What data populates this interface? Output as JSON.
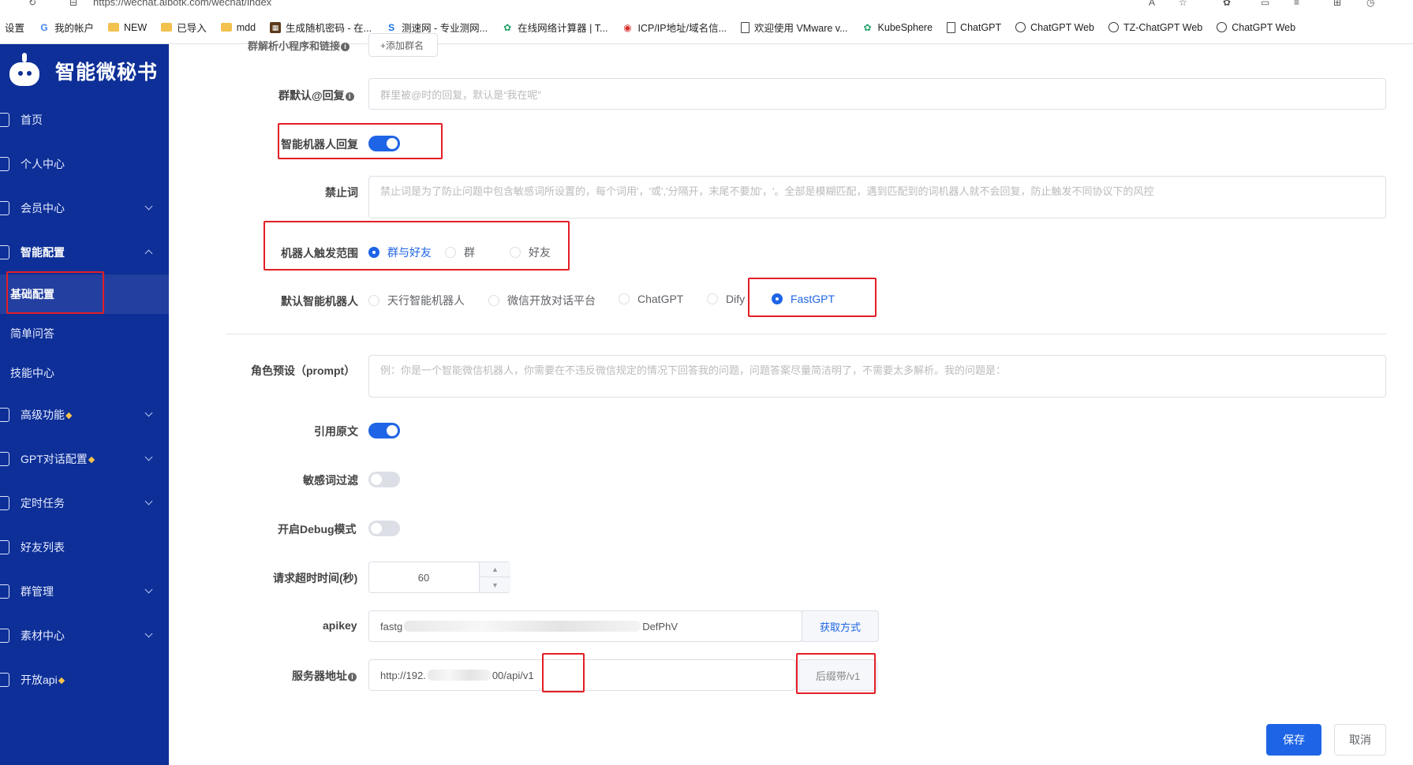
{
  "browser": {
    "url": "https://wechat.aibotk.com/wechat/index",
    "bookmarks": [
      {
        "label": "设置",
        "icon": "none-icon",
        "cls": ""
      },
      {
        "label": "我的帐户",
        "icon": "google-icon",
        "cls": "g"
      },
      {
        "label": "NEW",
        "icon": "folder-icon",
        "cls": "folder"
      },
      {
        "label": "已导入",
        "icon": "folder-icon",
        "cls": "folder"
      },
      {
        "label": "mdd",
        "icon": "folder-icon",
        "cls": "folder"
      },
      {
        "label": "生成随机密码 - 在...",
        "icon": "app-icon",
        "cls": "dark"
      },
      {
        "label": "测速网 - 专业测网...",
        "icon": "speed-icon",
        "cls": "blue"
      },
      {
        "label": "在线网络计算器 | T...",
        "icon": "gear-icon",
        "cls": "green"
      },
      {
        "label": "ICP/IP地址/域名信...",
        "icon": "site-icon",
        "cls": "red"
      },
      {
        "label": "欢迎使用 VMware v...",
        "icon": "page-icon",
        "cls": "doc"
      },
      {
        "label": "KubeSphere",
        "icon": "kubesphere-icon",
        "cls": "green"
      },
      {
        "label": "ChatGPT",
        "icon": "page-icon",
        "cls": "doc"
      },
      {
        "label": "ChatGPT Web",
        "icon": "openai-icon",
        "cls": "round"
      },
      {
        "label": "TZ-ChatGPT Web",
        "icon": "openai-icon",
        "cls": "round"
      },
      {
        "label": "ChatGPT Web",
        "icon": "openai-icon",
        "cls": "round"
      }
    ]
  },
  "sidebar": {
    "brand": "智能微秘书",
    "items": [
      {
        "label": "首页",
        "chevron": false
      },
      {
        "label": "个人中心",
        "chevron": false
      },
      {
        "label": "会员中心",
        "chevron": true
      }
    ],
    "open_group": {
      "label": "智能配置",
      "children": [
        "基础配置",
        "简单问答",
        "技能中心"
      ],
      "active": "基础配置"
    },
    "items_after": [
      {
        "label": "高级功能",
        "gem": true
      },
      {
        "label": "GPT对话配置",
        "gem": true
      },
      {
        "label": "定时任务",
        "gem": false
      },
      {
        "label": "好友列表",
        "gem": false,
        "nochev": true
      },
      {
        "label": "群管理",
        "gem": false
      },
      {
        "label": "素材中心",
        "gem": false
      },
      {
        "label": "开放api",
        "gem": true,
        "nochev": true
      }
    ],
    "gem_symbol": "◆"
  },
  "form": {
    "top_label_cut": "群解析小程序和链接",
    "top_button_cut": "+添加群名",
    "group_at_reply": {
      "label": "群默认@回复",
      "placeholder": "群里被@时的回复，默认是“我在呢”"
    },
    "smart_reply": {
      "label": "智能机器人回复",
      "on": true
    },
    "forbidden": {
      "label": "禁止词",
      "placeholder": "禁止词是为了防止问题中包含敏感词所设置的，每个词用'，'或','分隔开，末尾不要加'，'。全部是模糊匹配，遇到匹配到的词机器人就不会回复，防止触发不同协议下的风控"
    },
    "trigger_scope": {
      "label": "机器人触发范围",
      "options": [
        "群与好友",
        "群",
        "好友"
      ],
      "selected": "群与好友"
    },
    "default_bot": {
      "label": "默认智能机器人",
      "options": [
        "天行智能机器人",
        "微信开放对话平台",
        "ChatGPT",
        "Dify",
        "FastGPT"
      ],
      "selected": "FastGPT"
    },
    "prompt": {
      "label": "角色预设（prompt）",
      "placeholder": "例：你是一个智能微信机器人，你需要在不违反微信规定的情况下回答我的问题，问题答案尽量简洁明了，不需要太多解析。我的问题是："
    },
    "quote": {
      "label": "引用原文",
      "on": true
    },
    "sensitive": {
      "label": "敏感词过滤",
      "on": false
    },
    "debug": {
      "label": "开启Debug模式",
      "on": false
    },
    "timeout": {
      "label": "请求超时时间(秒)",
      "value": "60"
    },
    "apikey": {
      "label": "apikey",
      "prefix": "fastg",
      "suffix": "DefPhV",
      "addon": "获取方式"
    },
    "server": {
      "label": "服务器地址",
      "prefix": "http://192.",
      "middle": "00/a",
      "suffix": "pi/v1",
      "addon": "后缀带/v1"
    },
    "save": "保存",
    "cancel": "取消"
  }
}
